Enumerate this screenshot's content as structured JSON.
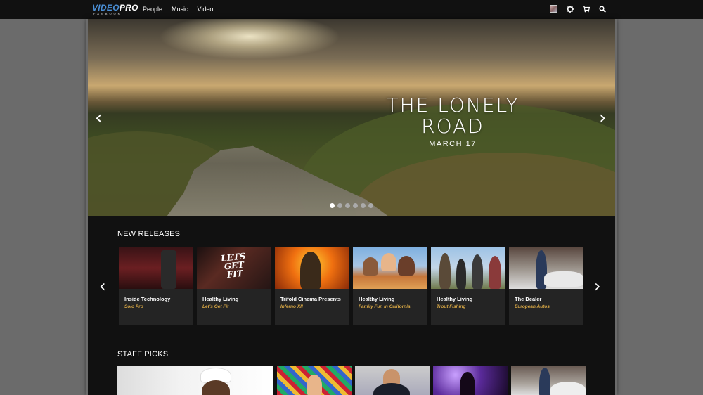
{
  "header": {
    "logo_main_a": "VIDEO",
    "logo_main_b": "PRO",
    "logo_sub": "FANBOOK",
    "nav": [
      "People",
      "Music",
      "Video"
    ],
    "icons": [
      "avatar",
      "gear-icon",
      "cart-icon",
      "search-icon"
    ]
  },
  "hero": {
    "title_line1": "THE LONELY",
    "title_line2": "ROAD",
    "date": "MARCH 17",
    "slide_count": 6,
    "active_slide": 1,
    "prev_glyph": "‹",
    "next_glyph": "›"
  },
  "new_releases": {
    "title": "NEW RELEASES",
    "items": [
      {
        "title": "Inside Technology",
        "subtitle": "Solo Pro"
      },
      {
        "title": "Healthy Living",
        "subtitle": "Let's Get Fit",
        "thumb_text": "LETS GET FIT"
      },
      {
        "title": "Trifold Cinema Presents",
        "subtitle": "Inferno XII"
      },
      {
        "title": "Healthy Living",
        "subtitle": "Family Fun in California"
      },
      {
        "title": "Healthy Living",
        "subtitle": "Trout Fishing"
      },
      {
        "title": "The Dealer",
        "subtitle": "European Autos"
      }
    ]
  },
  "staff_picks": {
    "title": "STAFF PICKS"
  },
  "colors": {
    "accent_subtitle": "#d9a845",
    "logo_blue": "#4a8fd6",
    "panel_bg": "#111111",
    "page_bg": "#6b6b6b",
    "card_bg": "#242424"
  }
}
